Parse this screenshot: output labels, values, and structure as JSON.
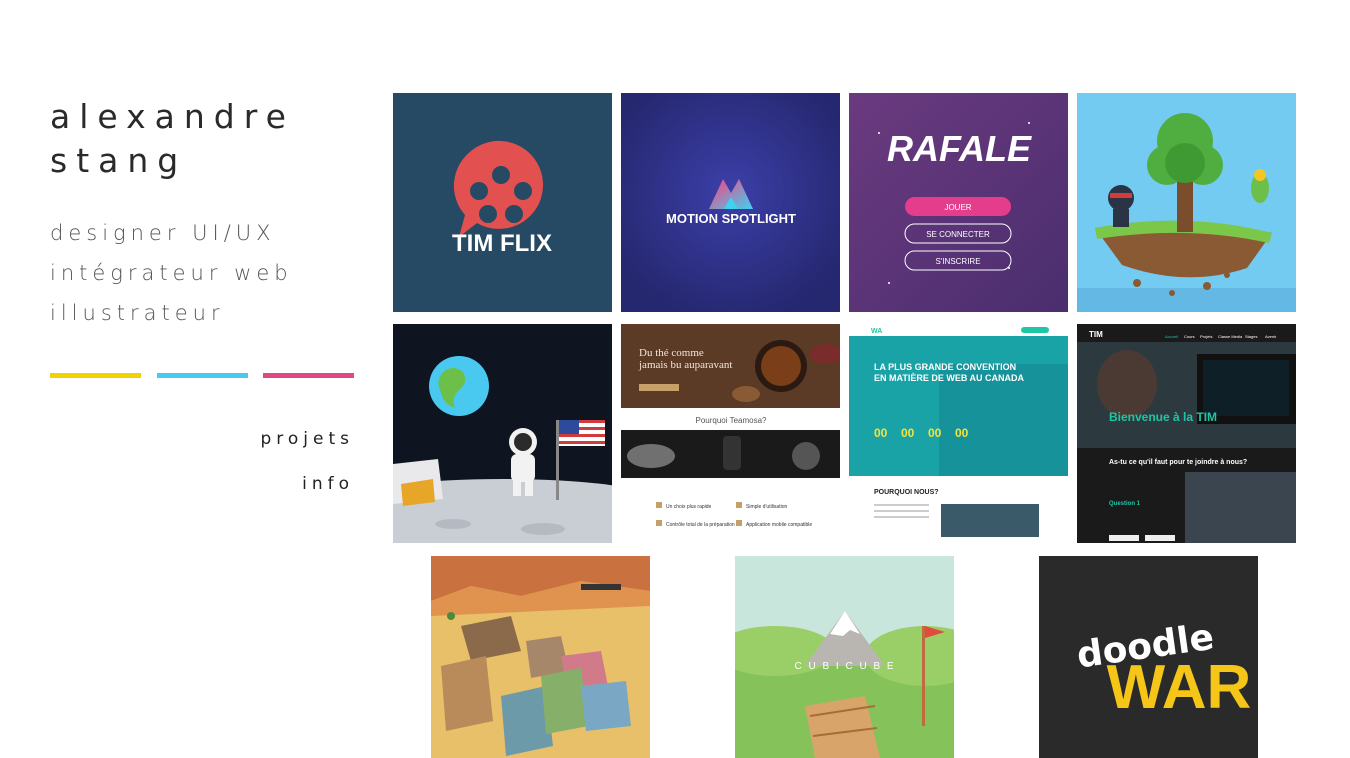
{
  "profile": {
    "name_line1": "alexandre",
    "name_line2": "stang",
    "roles": [
      "designer UI/UX",
      "intégrateur web",
      "illustrateur"
    ],
    "bar_colors": [
      "#f4d100",
      "#4ac9f0",
      "#e04783"
    ]
  },
  "nav": {
    "projects_label": "projets",
    "info_label": "info"
  },
  "projects": {
    "timflix": {
      "title": "TIM FLIX",
      "bg": "#264a63",
      "accent": "#e25050"
    },
    "motion": {
      "title": "MOTION SPOTLIGHT",
      "bg": "#2c2e8a"
    },
    "rafale": {
      "title": "RAFALE",
      "bg": "#5a3479",
      "buttons": [
        "JOUER",
        "SE CONNECTER",
        "S'INSCRIRE"
      ]
    },
    "ninja": {
      "bg": "#74cbf2"
    },
    "astronaut": {
      "bg": "#0e1420"
    },
    "teamosa": {
      "hero_line1": "Du thé comme",
      "hero_line2": "jamais bu auparavant",
      "section_title": "Pourquoi Teamosa?",
      "features": [
        "Un choix plus rapide",
        "Simple d'utilisation",
        "Contrôle total de la préparation",
        "Application mobile compatible"
      ]
    },
    "convention": {
      "logo": "WA",
      "headline1": "LA PLUS GRANDE CONVENTION",
      "headline2": "EN MATIÈRE DE WEB AU CANADA",
      "counters": [
        "00",
        "00",
        "00",
        "00"
      ],
      "section_title": "POURQUOI NOUS?"
    },
    "tim": {
      "logo": "TIM",
      "menu": [
        "Accueil",
        "Cours",
        "Projets",
        "Classe Media",
        "Stages",
        "Avenir"
      ],
      "welcome": "Bienvenue à la TIM",
      "question_title": "As-tu ce qu'il faut pour te joindre à nous?",
      "question_label": "Question 1"
    },
    "western": {
      "bg": "#e8c06a"
    },
    "cubicube": {
      "title": "C U B I C U B E"
    },
    "doodle": {
      "word1": "doodle",
      "word2": "WAR",
      "bg": "#2a2a2a",
      "accent": "#f5c518"
    }
  }
}
